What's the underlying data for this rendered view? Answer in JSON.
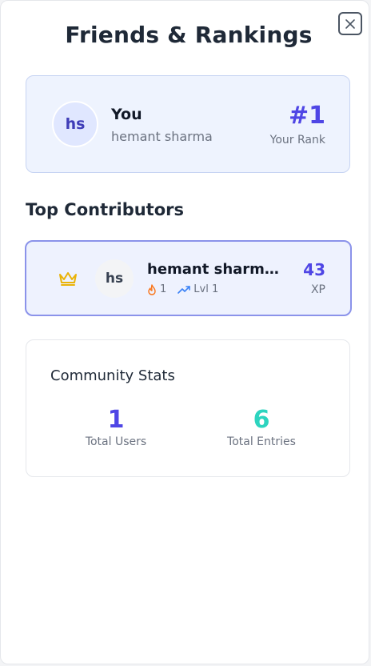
{
  "header": {
    "title": "Friends & Rankings",
    "close_icon": "close-icon"
  },
  "you_card": {
    "avatar_initials": "hs",
    "label": "You",
    "name": "hemant sharma",
    "rank": "#1",
    "rank_label": "Your Rank"
  },
  "top_contributors": {
    "title": "Top Contributors",
    "items": [
      {
        "icon": "crown-icon",
        "avatar_initials": "hs",
        "name": "hemant sharma...",
        "streak": "1",
        "streak_icon": "flame-icon",
        "level": "Lvl 1",
        "level_icon": "trending-up-icon",
        "xp": "43",
        "xp_label": "XP"
      }
    ]
  },
  "community_stats": {
    "title": "Community Stats",
    "stats": [
      {
        "value": "1",
        "label": "Total Users",
        "color": "#4f46e5"
      },
      {
        "value": "6",
        "label": "Total Entries",
        "color": "#2dd4bf"
      }
    ]
  },
  "colors": {
    "accent": "#4f46e5",
    "teal": "#2dd4bf",
    "crown": "#eab308",
    "flame": "#f97316",
    "trend": "#3b82f6"
  }
}
